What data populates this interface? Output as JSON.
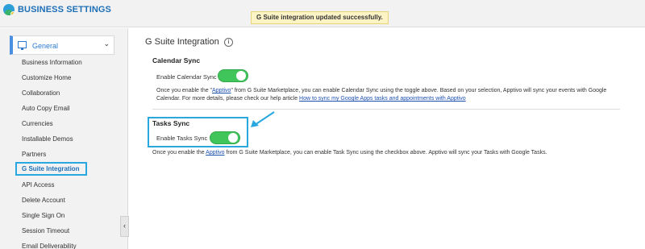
{
  "header": {
    "title": "BUSINESS SETTINGS",
    "toast": "G Suite integration updated successfully."
  },
  "sidebar": {
    "group_label": "General",
    "collapse_glyph": "‹",
    "items": [
      {
        "label": "Business Information",
        "active": false
      },
      {
        "label": "Customize Home",
        "active": false
      },
      {
        "label": "Collaboration",
        "active": false
      },
      {
        "label": "Auto Copy Email",
        "active": false
      },
      {
        "label": "Currencies",
        "active": false
      },
      {
        "label": "Installable Demos",
        "active": false
      },
      {
        "label": "Partners",
        "active": false
      },
      {
        "label": "G Suite Integration",
        "active": true
      },
      {
        "label": "API Access",
        "active": false
      },
      {
        "label": "Delete Account",
        "active": false
      },
      {
        "label": "Single Sign On",
        "active": false
      },
      {
        "label": "Session Timeout",
        "active": false
      },
      {
        "label": "Email Deliverability",
        "active": false
      }
    ]
  },
  "main": {
    "title": "G Suite Integration",
    "info_glyph": "i",
    "calendar": {
      "title": "Calendar Sync",
      "toggle_label": "Enable Calendar Sync",
      "enabled": true,
      "desc_pre": "Once you enable the \"",
      "desc_link1": "Apptivo",
      "desc_mid": "\" from G Suite Marketplace, you can enable Calendar Sync using the toggle above. Based on your selection, Apptivo will sync your events with Google Calendar. For more details, please check our help article ",
      "desc_link2": "How to sync my Google Apps tasks and appointments with Apptivo"
    },
    "tasks": {
      "title": "Tasks Sync",
      "toggle_label": "Enable Tasks Sync",
      "enabled": true,
      "desc_pre": "Once you enable the ",
      "desc_link": "Apptivo",
      "desc_post": " from G Suite Marketplace, you can enable Task Sync using the checkbox above. Apptivo will sync your Tasks with Google Tasks."
    }
  },
  "colors": {
    "accent": "#1d6fb8",
    "toggle_on": "#3fc55a",
    "highlight": "#29a8e0",
    "toast_bg": "#fdf4c5"
  }
}
